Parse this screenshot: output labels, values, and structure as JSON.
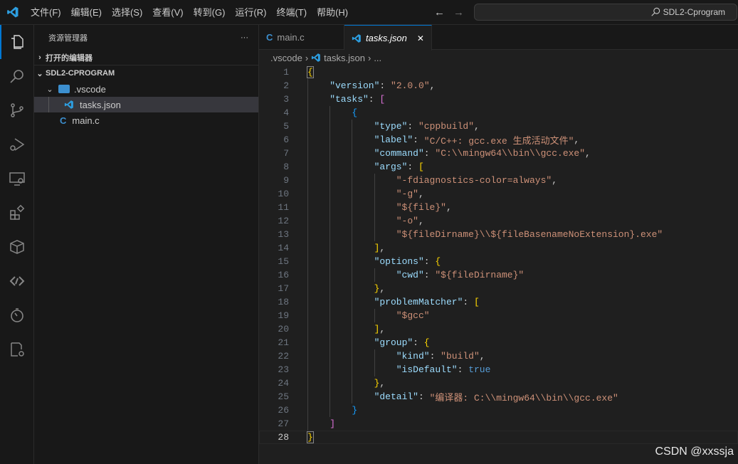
{
  "menu": [
    "文件(F)",
    "编辑(E)",
    "选择(S)",
    "查看(V)",
    "转到(G)",
    "运行(R)",
    "终端(T)",
    "帮助(H)"
  ],
  "search": {
    "text": "SDL2-Cprogram"
  },
  "sidebar": {
    "title": "资源管理器",
    "more": "···",
    "open_editors": "打开的编辑器",
    "project": "SDL2-CPROGRAM",
    "folder": ".vscode",
    "files": [
      "tasks.json",
      "main.c"
    ]
  },
  "tabs": [
    {
      "label": "main.c"
    },
    {
      "label": "tasks.json",
      "close": "✕"
    }
  ],
  "breadcrumb": {
    "folder": ".vscode",
    "file": "tasks.json",
    "more": "..."
  },
  "watermark": "CSDN @xxssja",
  "code": [
    [
      0,
      [
        [
          "b1",
          "{"
        ]
      ]
    ],
    [
      1,
      [
        [
          "k",
          "\"version\""
        ],
        [
          "p",
          ": "
        ],
        [
          "s",
          "\"2.0.0\""
        ],
        [
          "p",
          ","
        ]
      ]
    ],
    [
      1,
      [
        [
          "k",
          "\"tasks\""
        ],
        [
          "p",
          ": "
        ],
        [
          "b2",
          "["
        ]
      ]
    ],
    [
      2,
      [
        [
          "b3",
          "{"
        ]
      ]
    ],
    [
      3,
      [
        [
          "k",
          "\"type\""
        ],
        [
          "p",
          ": "
        ],
        [
          "s",
          "\"cppbuild\""
        ],
        [
          "p",
          ","
        ]
      ]
    ],
    [
      3,
      [
        [
          "k",
          "\"label\""
        ],
        [
          "p",
          ": "
        ],
        [
          "s",
          "\"C/C++: gcc.exe 生成活动文件\""
        ],
        [
          "p",
          ","
        ]
      ]
    ],
    [
      3,
      [
        [
          "k",
          "\"command\""
        ],
        [
          "p",
          ": "
        ],
        [
          "s",
          "\"C:\\\\mingw64\\\\bin\\\\gcc.exe\""
        ],
        [
          "p",
          ","
        ]
      ]
    ],
    [
      3,
      [
        [
          "k",
          "\"args\""
        ],
        [
          "p",
          ": "
        ],
        [
          "b1",
          "["
        ]
      ]
    ],
    [
      4,
      [
        [
          "s",
          "\"-fdiagnostics-color=always\""
        ],
        [
          "p",
          ","
        ]
      ]
    ],
    [
      4,
      [
        [
          "s",
          "\"-g\""
        ],
        [
          "p",
          ","
        ]
      ]
    ],
    [
      4,
      [
        [
          "s",
          "\"${file}\""
        ],
        [
          "p",
          ","
        ]
      ]
    ],
    [
      4,
      [
        [
          "s",
          "\"-o\""
        ],
        [
          "p",
          ","
        ]
      ]
    ],
    [
      4,
      [
        [
          "s",
          "\"${fileDirname}\\\\${fileBasenameNoExtension}.exe\""
        ]
      ]
    ],
    [
      3,
      [
        [
          "b1",
          "]"
        ],
        [
          "p",
          ","
        ]
      ]
    ],
    [
      3,
      [
        [
          "k",
          "\"options\""
        ],
        [
          "p",
          ": "
        ],
        [
          "b1",
          "{"
        ]
      ]
    ],
    [
      4,
      [
        [
          "k",
          "\"cwd\""
        ],
        [
          "p",
          ": "
        ],
        [
          "s",
          "\"${fileDirname}\""
        ]
      ]
    ],
    [
      3,
      [
        [
          "b1",
          "}"
        ],
        [
          "p",
          ","
        ]
      ]
    ],
    [
      3,
      [
        [
          "k",
          "\"problemMatcher\""
        ],
        [
          "p",
          ": "
        ],
        [
          "b1",
          "["
        ]
      ]
    ],
    [
      4,
      [
        [
          "s",
          "\"$gcc\""
        ]
      ]
    ],
    [
      3,
      [
        [
          "b1",
          "]"
        ],
        [
          "p",
          ","
        ]
      ]
    ],
    [
      3,
      [
        [
          "k",
          "\"group\""
        ],
        [
          "p",
          ": "
        ],
        [
          "b1",
          "{"
        ]
      ]
    ],
    [
      4,
      [
        [
          "k",
          "\"kind\""
        ],
        [
          "p",
          ": "
        ],
        [
          "s",
          "\"build\""
        ],
        [
          "p",
          ","
        ]
      ]
    ],
    [
      4,
      [
        [
          "k",
          "\"isDefault\""
        ],
        [
          "p",
          ": "
        ],
        [
          "v",
          "true"
        ]
      ]
    ],
    [
      3,
      [
        [
          "b1",
          "}"
        ],
        [
          "p",
          ","
        ]
      ]
    ],
    [
      3,
      [
        [
          "k",
          "\"detail\""
        ],
        [
          "p",
          ": "
        ],
        [
          "s",
          "\"编译器: C:\\\\mingw64\\\\bin\\\\gcc.exe\""
        ]
      ]
    ],
    [
      2,
      [
        [
          "b3",
          "}"
        ]
      ]
    ],
    [
      1,
      [
        [
          "b2",
          "]"
        ]
      ]
    ],
    [
      0,
      [
        [
          "b1",
          "}"
        ]
      ]
    ]
  ],
  "cursor_line": 28
}
